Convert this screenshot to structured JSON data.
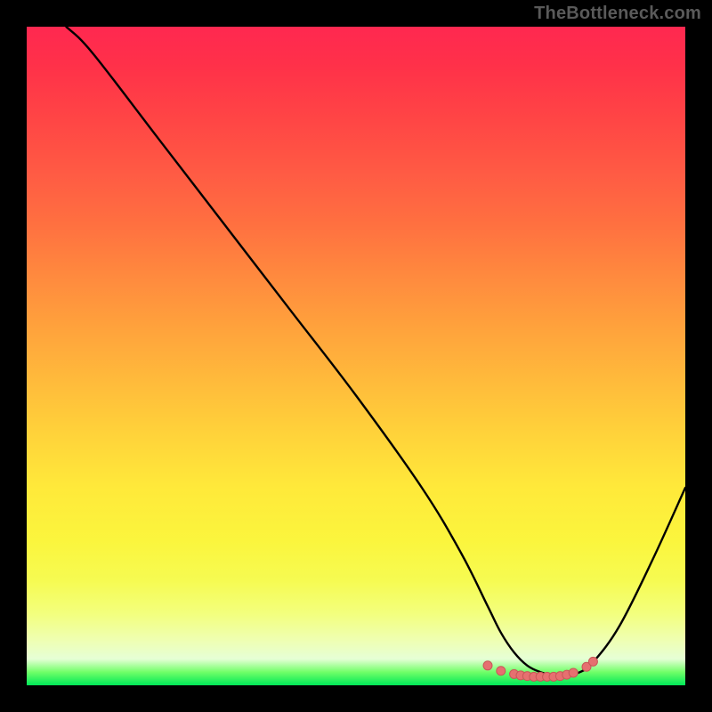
{
  "watermark": "TheBottleneck.com",
  "colors": {
    "background": "#000000",
    "curve": "#000000",
    "dot_fill": "#e67070",
    "dot_stroke": "#c85858"
  },
  "chart_data": {
    "type": "line",
    "title": "",
    "xlabel": "",
    "ylabel": "",
    "xlim": [
      0,
      100
    ],
    "ylim": [
      0,
      100
    ],
    "grid": false,
    "legend": false,
    "series": [
      {
        "name": "bottleneck-curve",
        "x": [
          6,
          10,
          20,
          30,
          40,
          50,
          60,
          66,
          70,
          72,
          74,
          76,
          78,
          80,
          82,
          84,
          86,
          90,
          95,
          100
        ],
        "y": [
          100,
          96,
          83,
          70,
          57,
          44,
          30,
          20,
          12,
          8,
          5,
          3,
          2,
          1.5,
          1.5,
          2,
          3.5,
          9,
          19,
          30
        ]
      }
    ],
    "dots": {
      "x": [
        70,
        72,
        74,
        75,
        76,
        77,
        78,
        79,
        80,
        81,
        82,
        83,
        85,
        86
      ],
      "y": [
        3,
        2.2,
        1.7,
        1.5,
        1.4,
        1.3,
        1.3,
        1.3,
        1.3,
        1.4,
        1.6,
        1.9,
        2.8,
        3.6
      ]
    }
  }
}
